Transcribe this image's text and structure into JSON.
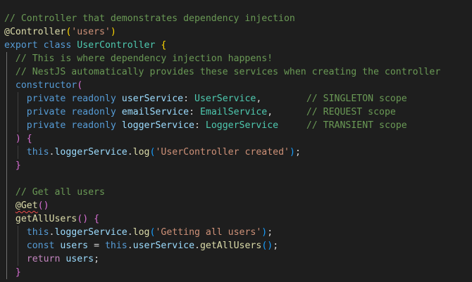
{
  "theme": {
    "background": "#1e1e1e",
    "comment": "#6a9955",
    "keyword": "#569cd6",
    "control": "#c586c0",
    "function": "#dcdcaa",
    "class": "#4ec9b0",
    "variable": "#9cdcfe",
    "string": "#ce9178",
    "bracket_1": "#ffd700",
    "bracket_2": "#da70d6",
    "bracket_3": "#179fff",
    "error": "#f14c4c"
  },
  "code": {
    "lines": [
      [
        [
          "cmt",
          "// Controller that demonstrates dependency injection"
        ]
      ],
      [
        [
          "fn",
          "@Controller"
        ],
        [
          "b1",
          "("
        ],
        [
          "str",
          "'users'"
        ],
        [
          "b1",
          ")"
        ]
      ],
      [
        [
          "kw",
          "export"
        ],
        [
          "pun",
          " "
        ],
        [
          "kw",
          "class"
        ],
        [
          "pun",
          " "
        ],
        [
          "cls",
          "UserController"
        ],
        [
          "pun",
          " "
        ],
        [
          "b1",
          "{"
        ]
      ],
      [
        [
          "pun",
          "  "
        ],
        [
          "cmt",
          "// This is where dependency injection happens!"
        ]
      ],
      [
        [
          "pun",
          "  "
        ],
        [
          "cmt",
          "// NestJS automatically provides these services when creating the controller"
        ]
      ],
      [
        [
          "pun",
          "  "
        ],
        [
          "kw",
          "constructor"
        ],
        [
          "b2",
          "("
        ]
      ],
      [
        [
          "pun",
          "    "
        ],
        [
          "kw",
          "private"
        ],
        [
          "pun",
          " "
        ],
        [
          "kw",
          "readonly"
        ],
        [
          "pun",
          " "
        ],
        [
          "var",
          "userService"
        ],
        [
          "pun",
          ": "
        ],
        [
          "cls",
          "UserService"
        ],
        [
          "pun",
          ",        "
        ],
        [
          "cmt",
          "// SINGLETON scope"
        ]
      ],
      [
        [
          "pun",
          "    "
        ],
        [
          "kw",
          "private"
        ],
        [
          "pun",
          " "
        ],
        [
          "kw",
          "readonly"
        ],
        [
          "pun",
          " "
        ],
        [
          "var",
          "emailService"
        ],
        [
          "pun",
          ": "
        ],
        [
          "cls",
          "EmailService"
        ],
        [
          "pun",
          ",      "
        ],
        [
          "cmt",
          "// REQUEST scope"
        ]
      ],
      [
        [
          "pun",
          "    "
        ],
        [
          "kw",
          "private"
        ],
        [
          "pun",
          " "
        ],
        [
          "kw",
          "readonly"
        ],
        [
          "pun",
          " "
        ],
        [
          "var",
          "loggerService"
        ],
        [
          "pun",
          ": "
        ],
        [
          "cls",
          "LoggerService"
        ],
        [
          "pun",
          "     "
        ],
        [
          "cmt",
          "// TRANSIENT scope"
        ]
      ],
      [
        [
          "pun",
          "  "
        ],
        [
          "b2",
          ")"
        ],
        [
          "pun",
          " "
        ],
        [
          "b2",
          "{"
        ]
      ],
      [
        [
          "pun",
          "    "
        ],
        [
          "kw",
          "this"
        ],
        [
          "pun",
          "."
        ],
        [
          "var",
          "loggerService"
        ],
        [
          "pun",
          "."
        ],
        [
          "fn",
          "log"
        ],
        [
          "b3",
          "("
        ],
        [
          "str",
          "'UserController created'"
        ],
        [
          "b3",
          ")"
        ],
        [
          "pun",
          ";"
        ]
      ],
      [
        [
          "pun",
          "  "
        ],
        [
          "b2",
          "}"
        ]
      ],
      [
        [
          "pun",
          ""
        ]
      ],
      [
        [
          "pun",
          "  "
        ],
        [
          "cmt",
          "// Get all users"
        ]
      ],
      [
        [
          "pun",
          "  "
        ],
        [
          "fnerr",
          "@Get"
        ],
        [
          "b2",
          "("
        ],
        [
          "b2",
          ")"
        ]
      ],
      [
        [
          "pun",
          "  "
        ],
        [
          "fn",
          "getAllUsers"
        ],
        [
          "b2",
          "("
        ],
        [
          "b2",
          ")"
        ],
        [
          "pun",
          " "
        ],
        [
          "b2",
          "{"
        ]
      ],
      [
        [
          "pun",
          "    "
        ],
        [
          "kw",
          "this"
        ],
        [
          "pun",
          "."
        ],
        [
          "var",
          "loggerService"
        ],
        [
          "pun",
          "."
        ],
        [
          "fn",
          "log"
        ],
        [
          "b3",
          "("
        ],
        [
          "str",
          "'Getting all users'"
        ],
        [
          "b3",
          ")"
        ],
        [
          "pun",
          ";"
        ]
      ],
      [
        [
          "pun",
          "    "
        ],
        [
          "kw",
          "const"
        ],
        [
          "pun",
          " "
        ],
        [
          "var",
          "users"
        ],
        [
          "pun",
          " = "
        ],
        [
          "kw",
          "this"
        ],
        [
          "pun",
          "."
        ],
        [
          "var",
          "userService"
        ],
        [
          "pun",
          "."
        ],
        [
          "fn",
          "getAllUsers"
        ],
        [
          "b3",
          "("
        ],
        [
          "b3",
          ")"
        ],
        [
          "pun",
          ";"
        ]
      ],
      [
        [
          "pun",
          "    "
        ],
        [
          "ctl",
          "return"
        ],
        [
          "pun",
          " "
        ],
        [
          "var",
          "users"
        ],
        [
          "pun",
          ";"
        ]
      ],
      [
        [
          "pun",
          "  "
        ],
        [
          "b2",
          "}"
        ]
      ]
    ]
  }
}
